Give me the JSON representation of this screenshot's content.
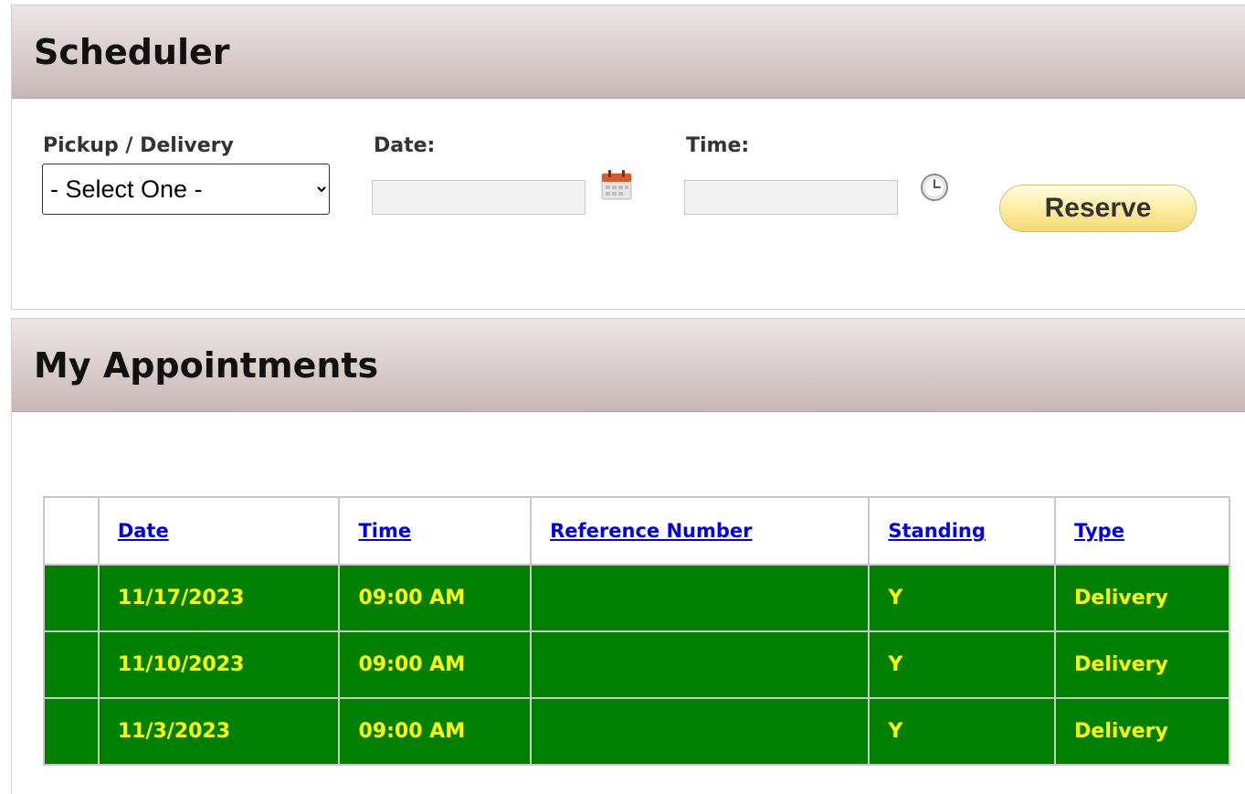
{
  "scheduler": {
    "title": "Scheduler",
    "type_label": "Pickup / Delivery",
    "type_selected": "- Select One -",
    "date_label": "Date:",
    "date_value": "",
    "time_label": "Time:",
    "time_value": "",
    "reserve_label": "Reserve"
  },
  "appointments": {
    "title": "My Appointments",
    "columns": [
      "Date",
      "Time",
      "Reference Number",
      "Standing",
      "Type"
    ],
    "rows": [
      {
        "date": "11/17/2023",
        "time": "09:00 AM",
        "reference": "",
        "standing": "Y",
        "type": "Delivery"
      },
      {
        "date": "11/10/2023",
        "time": "09:00 AM",
        "reference": "",
        "standing": "Y",
        "type": "Delivery"
      },
      {
        "date": "11/3/2023",
        "time": "09:00 AM",
        "reference": "",
        "standing": "Y",
        "type": "Delivery"
      }
    ],
    "row_background": "#008000",
    "row_text_color": "#ffff00",
    "link_color": "#0000ee"
  },
  "icons": {
    "date_picker": "calendar-icon",
    "time_picker": "clock-icon"
  }
}
